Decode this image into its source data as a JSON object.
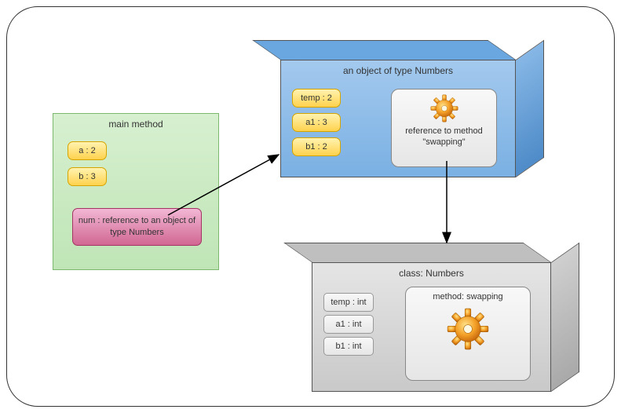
{
  "main": {
    "title": "main method",
    "a": "a : 2",
    "b": "b : 3",
    "num": "num : reference to an object of type Numbers"
  },
  "object": {
    "title": "an object of type Numbers",
    "temp": "temp : 2",
    "a1": "a1 : 3",
    "b1": "b1 : 2",
    "methodRef": "reference to method \"swapping\""
  },
  "class": {
    "title": "class: Numbers",
    "temp": "temp : int",
    "a1": "a1 : int",
    "b1": "b1 : int",
    "method": "method: swapping"
  }
}
